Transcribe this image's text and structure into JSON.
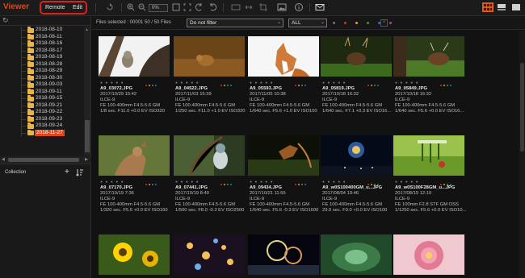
{
  "app": {
    "title": "Viewer"
  },
  "mode_buttons": {
    "remote": "Remote",
    "edit": "Edit"
  },
  "toolbar": {
    "zoom_value": "0%"
  },
  "tree": {
    "items": [
      {
        "label": "2018-08-10"
      },
      {
        "label": "2018-08-11"
      },
      {
        "label": "2018-08-16"
      },
      {
        "label": "2018-08-17"
      },
      {
        "label": "2018-08-19"
      },
      {
        "label": "2018-08-28"
      },
      {
        "label": "2018-08-29"
      },
      {
        "label": "2018-08-30"
      },
      {
        "label": "2018-09-03"
      },
      {
        "label": "2018-09-11"
      },
      {
        "label": "2018-09-15"
      },
      {
        "label": "2018-09-21"
      },
      {
        "label": "2018-09-22"
      },
      {
        "label": "2018-09-23"
      },
      {
        "label": "2018-09-24"
      },
      {
        "label": "2018-11-27"
      }
    ],
    "selected_index": 15
  },
  "collection": {
    "label": "Collection"
  },
  "filter": {
    "files_selected": "Files selected : 00001   50 / 50 Files",
    "filter_select": "Do not filter",
    "rating_select": "ALL"
  },
  "colors": {
    "accent": "#e0451b",
    "label_red": "#c8362b",
    "label_yellow": "#d4a72c",
    "label_green": "#3e9a3e",
    "label_blue": "#2f6ec9",
    "label_purple": "#8d4fb8"
  },
  "photos": [
    {
      "file": "A9_03072.JPG",
      "date": "2017/10/29 15:42",
      "camera": "ILCE-9",
      "lens": "FE 100-400mm F4.5-5.6 GM",
      "exposure": "1/8 sec. F11.0 +0.0 EV ISO320"
    },
    {
      "file": "A9_04522.JPG",
      "date": "2017/11/03 15:39",
      "camera": "ILCE-9",
      "lens": "FE 100-400mm F4.5-5.6 GM",
      "exposure": "1/250 sec. F11.0 +1.0 EV ISO320"
    },
    {
      "file": "A9_05593.JPG",
      "date": "2017/11/05 10:38",
      "camera": "ILCE-9",
      "lens": "FE 100-400mm F4.5-5.6 GM",
      "exposure": "1/640 sec. F5.6 +1.0 EV ISO100"
    },
    {
      "file": "A9_05819.JPG",
      "date": "2017/10/18 16:32",
      "camera": "ILCE-9",
      "lens": "FE 100-400mm F4.5-5.6 GM",
      "exposure": "1/640 sec. F7.1 +0.3 EV ISO16..."
    },
    {
      "file": "A9_05849.JPG",
      "date": "2017/10/18 16:32",
      "camera": "ILCE-9",
      "lens": "FE 100-400mm F4.5-5.6 GM",
      "exposure": "1/640 sec. F5.6 +0.0 EV ISO16..."
    },
    {
      "file": "A9_07170.JPG",
      "date": "2017/10/19 7:36",
      "camera": "ILCE-9",
      "lens": "FE 100-400mm F4.5-5.6 GM",
      "exposure": "1/320 sec. F5.6 +0.0 EV ISO160"
    },
    {
      "file": "A9_07441.JPG",
      "date": "2017/10/19 8:49",
      "camera": "ILCE-9",
      "lens": "FE 100-400mm F4.5-5.6 GM",
      "exposure": "1/500 sec. F8.0 -0.3 EV ISO2500"
    },
    {
      "file": "A9_09434.JPG",
      "date": "2017/10/21 11:55",
      "camera": "ILCE-9",
      "lens": "FE 100-400mm F4.5-5.6 GM",
      "exposure": "1/640 sec. F5.6 -0.3 EV ISO1600"
    },
    {
      "file": "A9_w0S100400GM_u...JPG",
      "date": "2017/08/04 19:46",
      "camera": "ILCE-9",
      "lens": "FE 100-400mm F4.5-5.6 GM",
      "exposure": "29.0 sec. F9.0 +0.0 EV ISO100"
    },
    {
      "file": "A9_w0S100F28GM_u...JPG",
      "date": "2017/08/19 12:19",
      "camera": "ILCE-9",
      "lens": "FE 100mm F2.8 STF GM OSS",
      "exposure": "1/1250 sec. F5.6 +0.0 EV ISO10..."
    },
    {
      "file": "",
      "date": "",
      "camera": "",
      "lens": "",
      "exposure": ""
    },
    {
      "file": "",
      "date": "",
      "camera": "",
      "lens": "",
      "exposure": ""
    },
    {
      "file": "",
      "date": "",
      "camera": "",
      "lens": "",
      "exposure": ""
    },
    {
      "file": "",
      "date": "",
      "camera": "",
      "lens": "",
      "exposure": ""
    },
    {
      "file": "",
      "date": "",
      "camera": "",
      "lens": "",
      "exposure": ""
    }
  ]
}
